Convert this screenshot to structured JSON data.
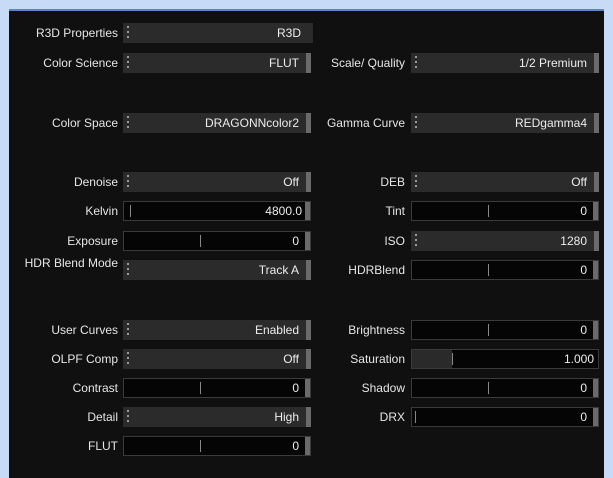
{
  "left": {
    "r3d_properties": {
      "label": "R3D Properties",
      "value": "R3D"
    },
    "color_science": {
      "label": "Color Science",
      "value": "FLUT"
    },
    "color_space": {
      "label": "Color Space",
      "value": "DRAGONNcolor2"
    },
    "denoise": {
      "label": "Denoise",
      "value": "Off"
    },
    "kelvin": {
      "label": "Kelvin",
      "value": "4800.0"
    },
    "exposure": {
      "label": "Exposure",
      "value": "0"
    },
    "hdr_blend_mode": {
      "label": "HDR Blend Mode",
      "value": "Track A"
    },
    "user_curves": {
      "label": "User Curves",
      "value": "Enabled"
    },
    "olpf_comp": {
      "label": "OLPF Comp",
      "value": "Off"
    },
    "contrast": {
      "label": "Contrast",
      "value": "0"
    },
    "detail": {
      "label": "Detail",
      "value": "High"
    },
    "flut": {
      "label": "FLUT",
      "value": "0"
    }
  },
  "right": {
    "scale_quality": {
      "label": "Scale/ Quality",
      "value": "1/2 Premium"
    },
    "gamma_curve": {
      "label": "Gamma Curve",
      "value": "REDgamma4"
    },
    "deb": {
      "label": "DEB",
      "value": "Off"
    },
    "tint": {
      "label": "Tint",
      "value": "0"
    },
    "iso": {
      "label": "ISO",
      "value": "1280"
    },
    "hdrblend": {
      "label": "HDRBlend",
      "value": "0"
    },
    "brightness": {
      "label": "Brightness",
      "value": "0"
    },
    "saturation": {
      "label": "Saturation",
      "value": "1.000"
    },
    "shadow": {
      "label": "Shadow",
      "value": "0"
    },
    "drx": {
      "label": "DRX",
      "value": "0"
    }
  },
  "colors": {
    "background": "#c7dbf6",
    "panel": "#101010",
    "dropdown": "#2b2b2b",
    "field": "#050505"
  }
}
